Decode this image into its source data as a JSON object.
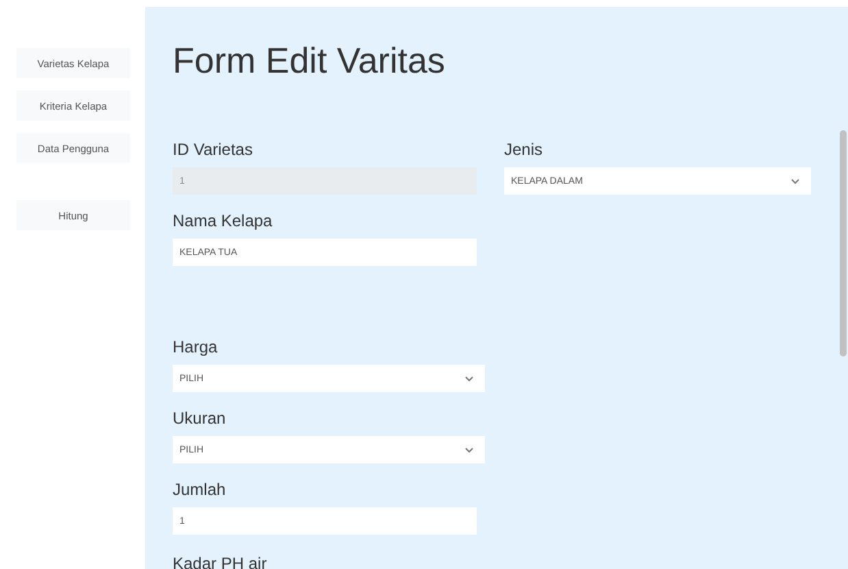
{
  "sidebar": {
    "items": [
      {
        "label": "Varietas Kelapa"
      },
      {
        "label": "Kriteria Kelapa"
      },
      {
        "label": "Data Pengguna"
      },
      {
        "label": "Hitung"
      }
    ]
  },
  "form": {
    "title": "Form Edit Varitas",
    "fields": [
      {
        "label": "ID Varietas",
        "kind": "input",
        "value": "1",
        "disabled": true
      },
      {
        "label": "Jenis",
        "kind": "select",
        "value": "KELAPA DALAM",
        "disabled": false
      },
      {
        "label": "Nama Kelapa",
        "kind": "input",
        "value": "KELAPA TUA",
        "disabled": false
      },
      {
        "label": "Harga",
        "kind": "select",
        "value": "PILIH",
        "disabled": false
      },
      {
        "label": "Ukuran",
        "kind": "select",
        "value": "PILIH",
        "disabled": false
      },
      {
        "label": "Jumlah",
        "kind": "input",
        "value": "1",
        "disabled": false
      },
      {
        "label": "Kadar PH air",
        "kind": "label"
      }
    ]
  }
}
